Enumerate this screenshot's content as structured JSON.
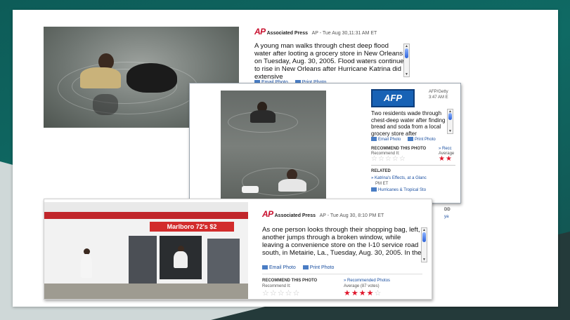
{
  "panel1": {
    "source_logo": "AP",
    "source_name": "Associated Press",
    "byline": "AP - Tue Aug 30,11:31 AM ET",
    "caption": "A young man walks through chest deep flood water after looting a grocery store in New Orleans on Tuesday, Aug. 30, 2005. Flood waters continue to rise in New Orleans after Hurricane Katrina did extensive",
    "email_link": "Email Photo",
    "print_link": "Print Photo"
  },
  "panel2": {
    "source_logo": "AFP",
    "byline_line1": "AFP/Getty",
    "byline_line2": "3:47 AM E",
    "caption": "Two residents wade through chest-deep water after finding bread and soda from a local grocery store after",
    "email_link": "Email Photo",
    "print_link": "Print Photo",
    "recommend_title": "RECOMMEND THIS PHOTO",
    "recommend_link": "» Recc",
    "recommend_it": "Recommend It:",
    "average": "Average",
    "related_title": "RELATED",
    "related_items": [
      "» Katrina's Effects, at a Glanc",
      "PM ET",
      "Hurricanes & Tropical Sto"
    ],
    "cut_text_1": "DD",
    "cut_text_2": "ya"
  },
  "panel3": {
    "source_logo": "AP",
    "source_name": "Associated Press",
    "byline": "AP - Tue Aug 30, 8:10 PM ET",
    "caption": "As one person looks through their shopping bag, left, another jumps through a broken window, while leaving a convenience store on the I-10 service road south, in Metairie, La., Tuesday, Aug. 30, 2005. In the",
    "email_link": "Email Photo",
    "print_link": "Print Photo",
    "recommend_title": "RECOMMEND THIS PHOTO",
    "recommend_link": "» Recommended Photos",
    "recommend_it": "Recommend It:",
    "average": "Average (87 votes)",
    "store_sign": "Marlboro 72's $2",
    "rating_value": 4,
    "rating_max": 5
  },
  "colors": {
    "ap_red": "#c8102e",
    "link_blue": "#1a4fa0",
    "afp_blue": "#1862b5",
    "star_red": "#e0162b",
    "slide_teal": "#0f6a64"
  }
}
